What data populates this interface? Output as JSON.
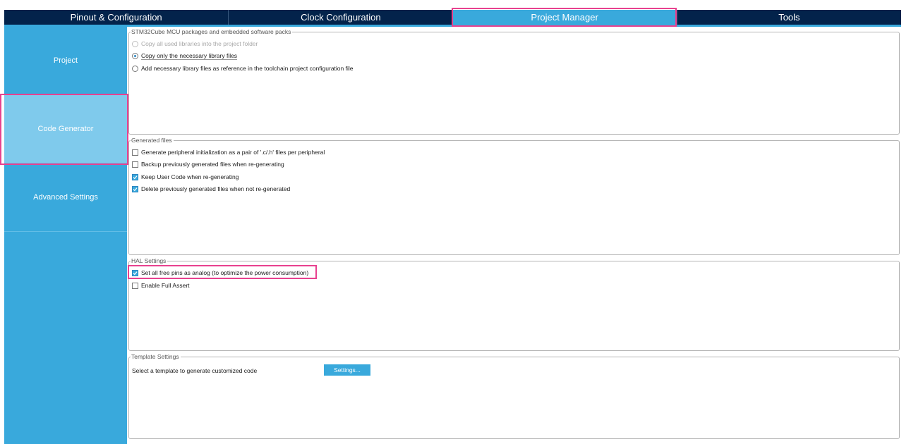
{
  "tabs": [
    {
      "label": "Pinout & Configuration"
    },
    {
      "label": "Clock Configuration"
    },
    {
      "label": "Project Manager"
    },
    {
      "label": "Tools"
    }
  ],
  "sidebar": {
    "items": [
      {
        "label": "Project"
      },
      {
        "label": "Code Generator"
      },
      {
        "label": "Advanced Settings"
      }
    ]
  },
  "packages": {
    "legend": "STM32Cube MCU packages and embedded software packs",
    "options": [
      {
        "label": "Copy all used libraries into the project folder",
        "selected": false,
        "enabled": false
      },
      {
        "label": "Copy only the necessary library files",
        "selected": true,
        "enabled": true
      },
      {
        "label": "Add necessary library files as reference in the toolchain project configuration file",
        "selected": false,
        "enabled": true
      }
    ]
  },
  "generated_files": {
    "legend": "Generated files",
    "options": [
      {
        "label": "Generate peripheral initialization as a pair of '.c/.h' files per peripheral",
        "checked": false
      },
      {
        "label": "Backup previously generated files when re-generating",
        "checked": false
      },
      {
        "label": "Keep User Code when re-generating",
        "checked": true
      },
      {
        "label": "Delete previously generated files when not re-generated",
        "checked": true
      }
    ]
  },
  "hal_settings": {
    "legend": "HAL Settings",
    "options": [
      {
        "label": "Set all free pins as analog (to optimize the power consumption)",
        "checked": true
      },
      {
        "label": "Enable Full Assert",
        "checked": false
      }
    ]
  },
  "template_settings": {
    "legend": "Template Settings",
    "description": "Select a template to generate customized code",
    "button_label": "Settings..."
  },
  "colors": {
    "tabbar_bg": "#03234b",
    "accent": "#39a9dc",
    "sidebar_active": "#7fcaec",
    "highlight": "#e8418f"
  },
  "icons": {
    "checkbox_checked": "check-mark-icon",
    "radio_selected": "radio-dot-icon"
  }
}
